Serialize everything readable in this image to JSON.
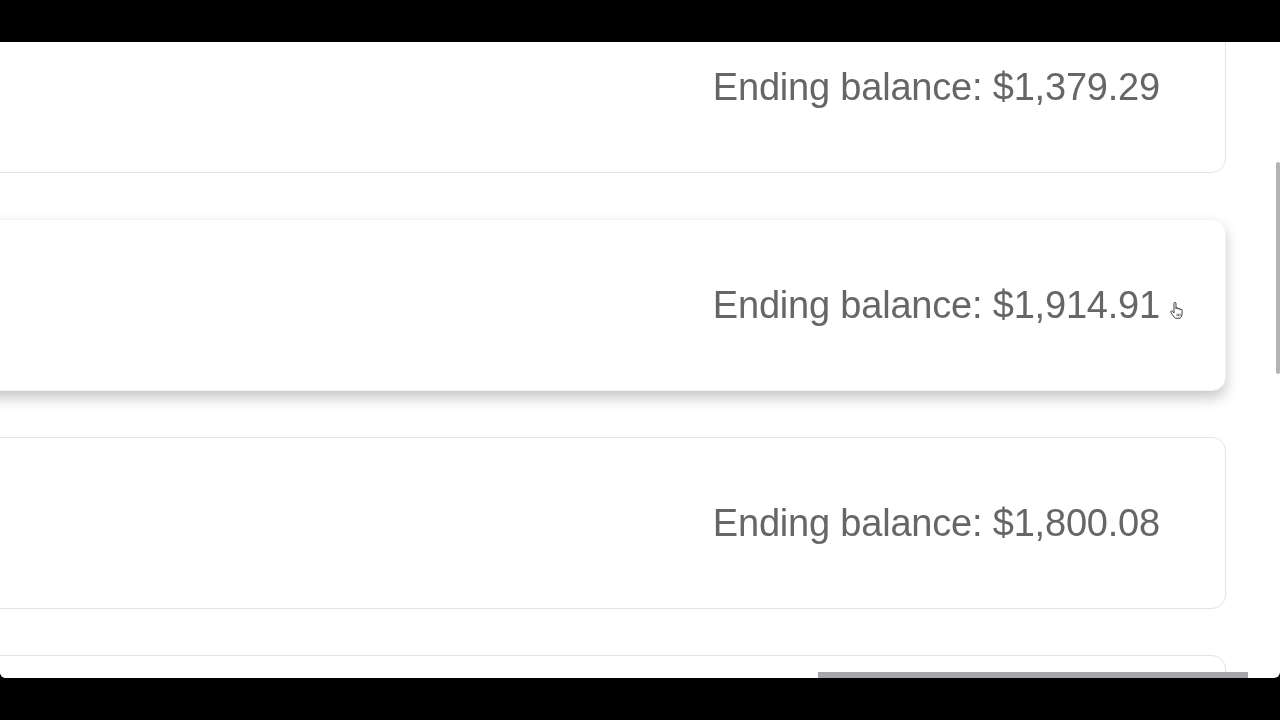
{
  "cards": [
    {
      "ending_balance": "Ending balance: $1,379.29",
      "hovered": false
    },
    {
      "ending_balance": "Ending balance: $1,914.91",
      "hovered": true
    },
    {
      "ending_balance": "Ending balance: $1,800.08",
      "hovered": false
    },
    {
      "hovered": false
    }
  ]
}
